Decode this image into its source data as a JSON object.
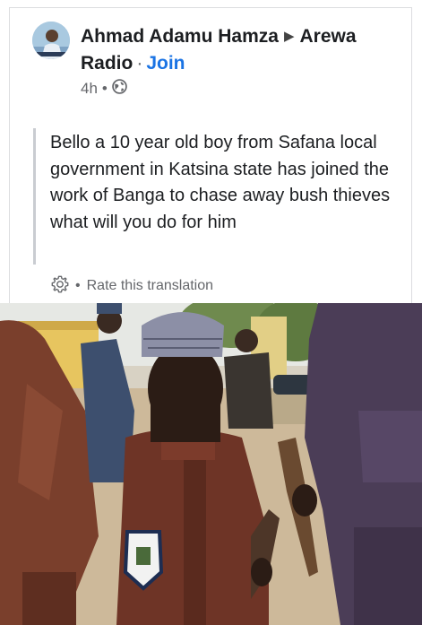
{
  "post": {
    "author": "Ahmad Adamu Hamza",
    "group": "Arewa Radio",
    "join_label": "Join",
    "time": "4h",
    "text": "Bello a 10 year old boy from Safana local government in Katsina state has joined the work of Banga to chase away bush thieves what will you do for him",
    "rate_translation": "Rate this translation"
  },
  "icons": {
    "arrow": "triangle-right-icon",
    "privacy": "globe-icon",
    "settings": "gear-icon"
  },
  "colors": {
    "link": "#1b74e4",
    "secondary_text": "#65676b",
    "quote_bar": "#c9ccd1"
  }
}
